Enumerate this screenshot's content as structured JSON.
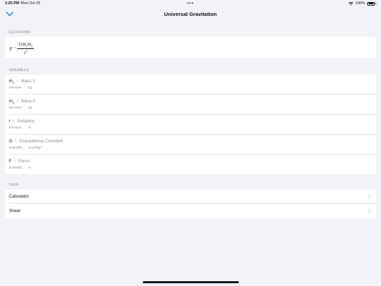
{
  "status": {
    "time": "3:25 PM",
    "date": "Mon Oct 25",
    "battery": "100%"
  },
  "nav": {
    "title": "Universal Gravitation",
    "back_icon": "chevron-down-icon"
  },
  "equations": {
    "header": "EQUATIONS",
    "lhs": "F",
    "relation": "=",
    "numerator": "Gm",
    "sub1": "1",
    "mid": "m",
    "sub2": "2",
    "denominator": "r",
    "exponent": "2"
  },
  "variables": {
    "header": "VARIABLES",
    "items": [
      {
        "symbol": "m",
        "sub": "1",
        "name": "Mass 1",
        "type": "Decimal",
        "unit": "kg"
      },
      {
        "symbol": "m",
        "sub": "2",
        "name": "Mass 2",
        "type": "Decimal",
        "unit": "kg"
      },
      {
        "symbol": "r",
        "sub": "",
        "name": "Distance",
        "type": "Decimal",
        "unit": "m"
      },
      {
        "symbol": "G",
        "sub": "",
        "name": "Gravitational Constant",
        "type": "Scientific",
        "unit": "N·m²/kg²"
      },
      {
        "symbol": "F",
        "sub": "",
        "name": "Force",
        "type": "Scientific",
        "unit": "N"
      }
    ]
  },
  "view": {
    "header": "VIEW",
    "items": [
      {
        "label": "Calculator"
      },
      {
        "label": "Sheet"
      }
    ]
  },
  "colors": {
    "background": "#f2f2f7",
    "accent": "#007aff",
    "secondary_text": "#8a8a8e"
  }
}
